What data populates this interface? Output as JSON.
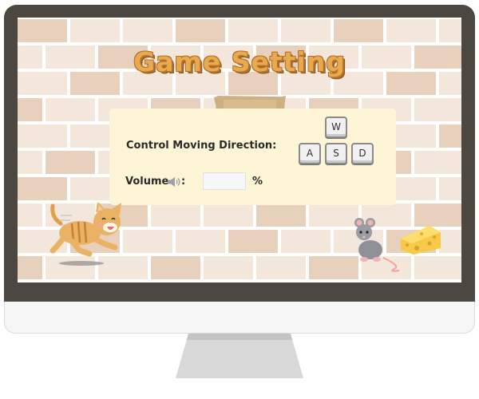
{
  "title": "Game Setting",
  "settings": {
    "direction_label": "Control Moving Direction:",
    "volume_label": "Volume",
    "volume_colon": ":",
    "volume_value": "",
    "volume_unit": "%"
  },
  "keys": {
    "up": "W",
    "left": "A",
    "down": "S",
    "right": "D"
  },
  "icons": {
    "speaker": "speaker-icon",
    "cat": "cat-icon",
    "mouse": "mouse-icon",
    "cheese": "cheese-icon"
  },
  "colors": {
    "monitor_frame": "#4d4742",
    "brick_light": "#f3e6da",
    "brick_dark": "#e7d1bd",
    "mortar": "#ffffff",
    "panel": "#fdf5d6",
    "title_fill": "#e9a94e",
    "title_outline": "#b4712a"
  }
}
